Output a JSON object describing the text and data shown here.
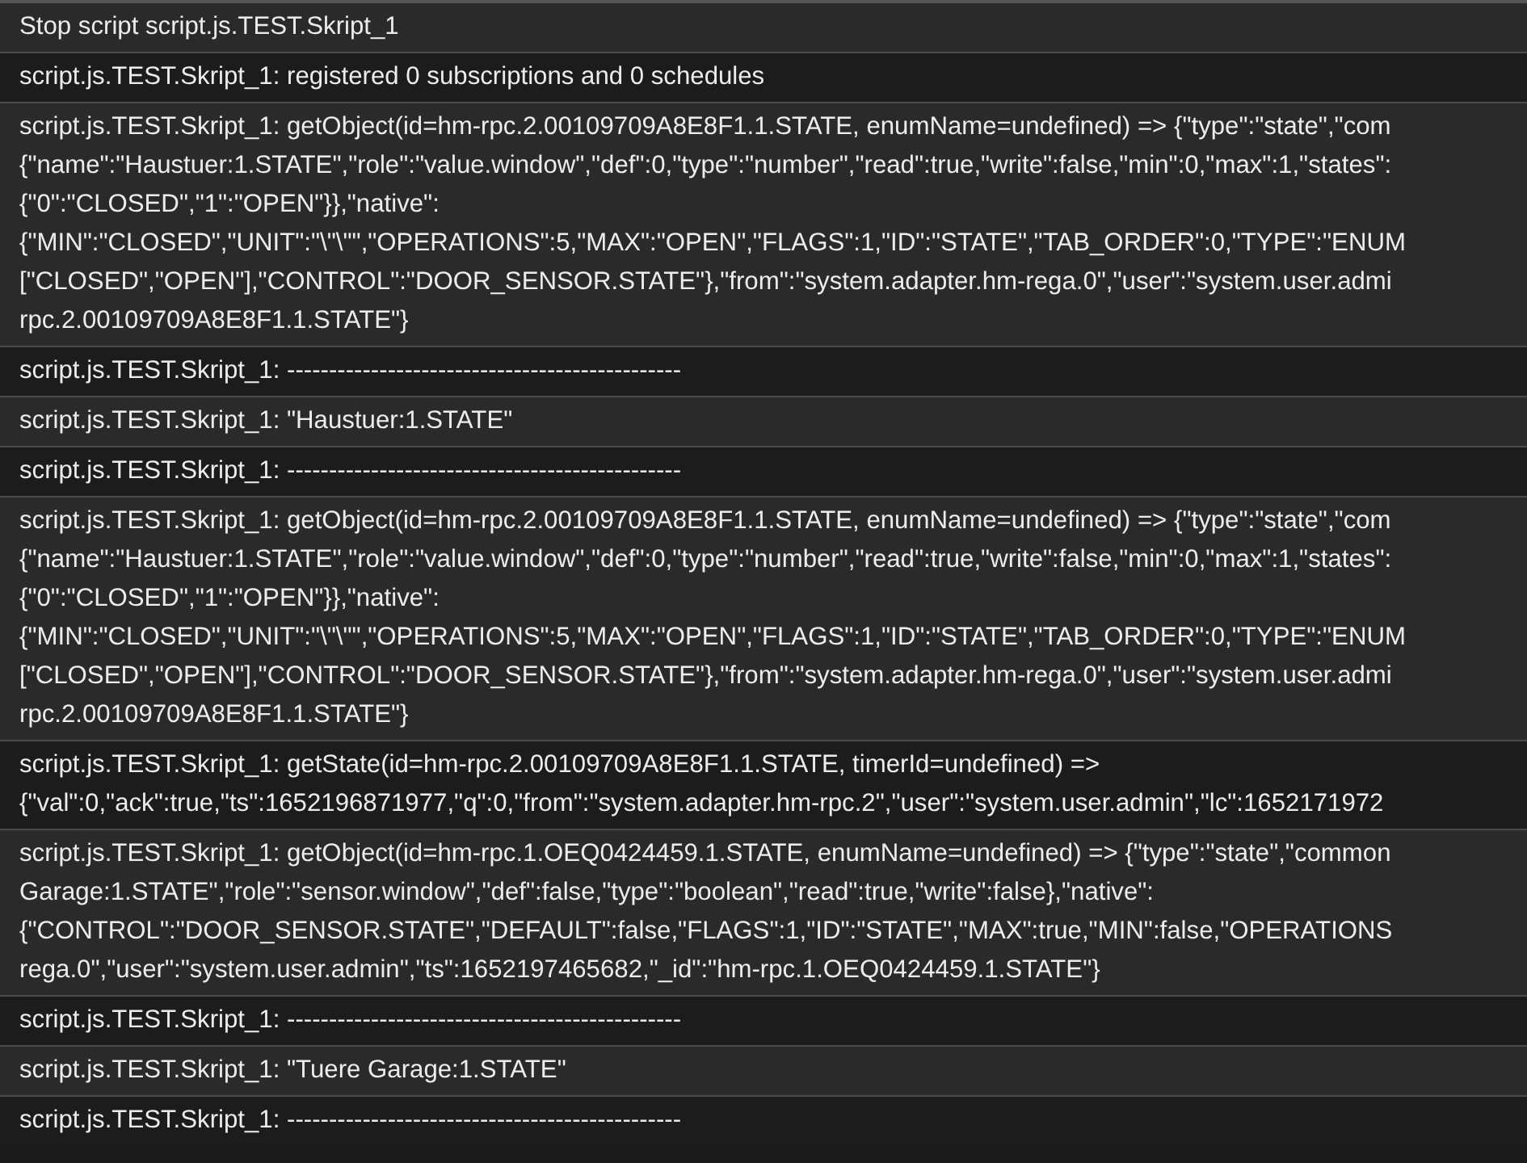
{
  "log_entries": [
    {
      "lines": [
        "Stop script script.js.TEST.Skript_1"
      ]
    },
    {
      "lines": [
        "script.js.TEST.Skript_1: registered 0 subscriptions and 0 schedules"
      ]
    },
    {
      "lines": [
        "script.js.TEST.Skript_1: getObject(id=hm-rpc.2.00109709A8E8F1.1.STATE, enumName=undefined) => {\"type\":\"state\",\"com",
        "{\"name\":\"Haustuer:1.STATE\",\"role\":\"value.window\",\"def\":0,\"type\":\"number\",\"read\":true,\"write\":false,\"min\":0,\"max\":1,\"states\":",
        "{\"0\":\"CLOSED\",\"1\":\"OPEN\"}},\"native\":",
        "{\"MIN\":\"CLOSED\",\"UNIT\":\"\\\"\\\"\",\"OPERATIONS\":5,\"MAX\":\"OPEN\",\"FLAGS\":1,\"ID\":\"STATE\",\"TAB_ORDER\":0,\"TYPE\":\"ENUM",
        "[\"CLOSED\",\"OPEN\"],\"CONTROL\":\"DOOR_SENSOR.STATE\"},\"from\":\"system.adapter.hm-rega.0\",\"user\":\"system.user.admi",
        "rpc.2.00109709A8E8F1.1.STATE\"}"
      ]
    },
    {
      "lines": [
        "script.js.TEST.Skript_1: -----------------------------------------------"
      ]
    },
    {
      "lines": [
        "script.js.TEST.Skript_1: \"Haustuer:1.STATE\""
      ]
    },
    {
      "lines": [
        "script.js.TEST.Skript_1: -----------------------------------------------"
      ]
    },
    {
      "lines": [
        "script.js.TEST.Skript_1: getObject(id=hm-rpc.2.00109709A8E8F1.1.STATE, enumName=undefined) => {\"type\":\"state\",\"com",
        "{\"name\":\"Haustuer:1.STATE\",\"role\":\"value.window\",\"def\":0,\"type\":\"number\",\"read\":true,\"write\":false,\"min\":0,\"max\":1,\"states\":",
        "{\"0\":\"CLOSED\",\"1\":\"OPEN\"}},\"native\":",
        "{\"MIN\":\"CLOSED\",\"UNIT\":\"\\\"\\\"\",\"OPERATIONS\":5,\"MAX\":\"OPEN\",\"FLAGS\":1,\"ID\":\"STATE\",\"TAB_ORDER\":0,\"TYPE\":\"ENUM",
        "[\"CLOSED\",\"OPEN\"],\"CONTROL\":\"DOOR_SENSOR.STATE\"},\"from\":\"system.adapter.hm-rega.0\",\"user\":\"system.user.admi",
        "rpc.2.00109709A8E8F1.1.STATE\"}"
      ]
    },
    {
      "lines": [
        "script.js.TEST.Skript_1: getState(id=hm-rpc.2.00109709A8E8F1.1.STATE, timerId=undefined) =>",
        "{\"val\":0,\"ack\":true,\"ts\":1652196871977,\"q\":0,\"from\":\"system.adapter.hm-rpc.2\",\"user\":\"system.user.admin\",\"lc\":1652171972"
      ]
    },
    {
      "lines": [
        "script.js.TEST.Skript_1: getObject(id=hm-rpc.1.OEQ0424459.1.STATE, enumName=undefined) => {\"type\":\"state\",\"common",
        "Garage:1.STATE\",\"role\":\"sensor.window\",\"def\":false,\"type\":\"boolean\",\"read\":true,\"write\":false},\"native\":",
        "{\"CONTROL\":\"DOOR_SENSOR.STATE\",\"DEFAULT\":false,\"FLAGS\":1,\"ID\":\"STATE\",\"MAX\":true,\"MIN\":false,\"OPERATIONS",
        "rega.0\",\"user\":\"system.user.admin\",\"ts\":1652197465682,\"_id\":\"hm-rpc.1.OEQ0424459.1.STATE\"}"
      ]
    },
    {
      "lines": [
        "script.js.TEST.Skript_1: -----------------------------------------------"
      ]
    },
    {
      "lines": [
        "script.js.TEST.Skript_1: \"Tuere Garage:1.STATE\""
      ]
    },
    {
      "lines": [
        "script.js.TEST.Skript_1: -----------------------------------------------"
      ]
    }
  ]
}
